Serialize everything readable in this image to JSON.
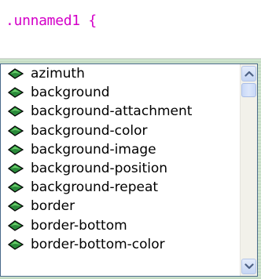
{
  "editor": {
    "code_line": ".unnamed1 {"
  },
  "property_list": {
    "items": [
      "azimuth",
      "background",
      "background-attachment",
      "background-color",
      "background-image",
      "background-position",
      "background-repeat",
      "border",
      "border-bottom",
      "border-bottom-color"
    ],
    "item_icon": "css-property-diamond-icon",
    "icon_color": "#2a8a3a"
  },
  "colors": {
    "code_text": "#d400c8",
    "list_border": "#4a6a8a",
    "scrollbar_button": "#c6d6f4"
  }
}
